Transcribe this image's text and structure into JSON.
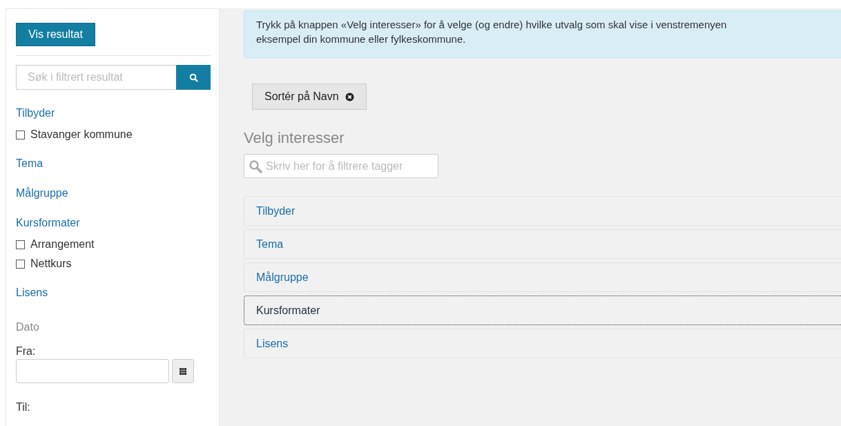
{
  "sidebar": {
    "show_results_button": "Vis resultat",
    "search": {
      "placeholder": "Søk i filtrert resultat"
    },
    "sections": [
      {
        "title": "Tilbyder",
        "options": [
          {
            "label": "Stavanger kommune",
            "checked": false
          }
        ]
      },
      {
        "title": "Tema"
      },
      {
        "title": "Målgruppe"
      },
      {
        "title": "Kursformater",
        "options": [
          {
            "label": "Arrangement",
            "checked": false
          },
          {
            "label": "Nettkurs",
            "checked": false
          }
        ]
      },
      {
        "title": "Lisens"
      }
    ],
    "date": {
      "title": "Dato",
      "from_label": "Fra:",
      "to_label": "Til:"
    }
  },
  "main": {
    "info": "Trykk på knappen «Velg interesser» for å velge (og endre) hvilke utvalg som skal vise i venstremenyen",
    "info_line_2": "eksempel din kommune eller fylkeskommune.",
    "sort_button": "Sortér på Navn",
    "heading": "Velg interesser",
    "filter": {
      "placeholder": "Skriv her for å filtrere tagger"
    },
    "interests": [
      {
        "label": "Tilbyder",
        "focused": false
      },
      {
        "label": "Tema",
        "focused": false
      },
      {
        "label": "Målgruppe",
        "focused": false
      },
      {
        "label": "Kursformater",
        "focused": true
      },
      {
        "label": "Lisens",
        "focused": false
      }
    ]
  }
}
